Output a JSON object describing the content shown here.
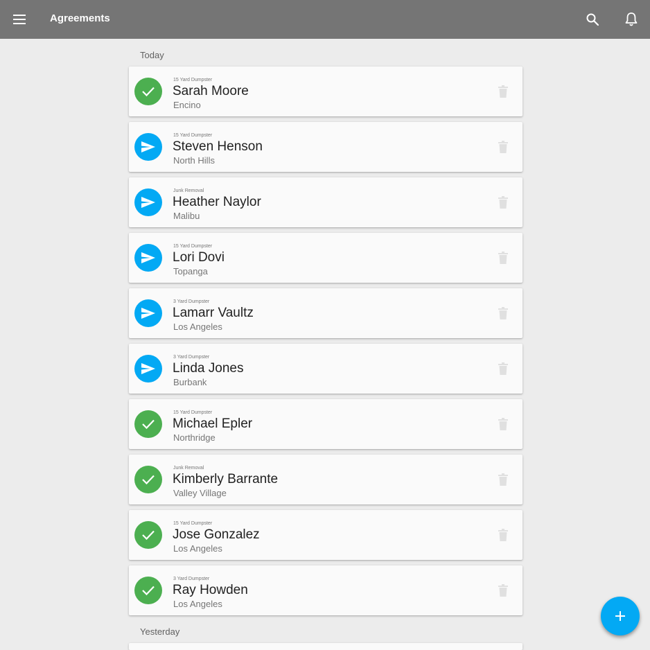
{
  "appbar": {
    "title": "Agreements",
    "icons": [
      "menu-icon",
      "search-icon",
      "bell-icon"
    ]
  },
  "sections": [
    {
      "label": "Today",
      "agreements": [
        {
          "service": "15 Yard Dumpster",
          "name": "Sarah Moore",
          "city": "Encino",
          "status": "signed"
        },
        {
          "service": "15 Yard Dumpster",
          "name": "Steven Henson",
          "city": "North Hills",
          "status": "sent"
        },
        {
          "service": "Junk Removal",
          "name": "Heather Naylor",
          "city": "Malibu",
          "status": "sent"
        },
        {
          "service": "15 Yard Dumpster",
          "name": "Lori Dovi",
          "city": "Topanga",
          "status": "sent"
        },
        {
          "service": "3 Yard Dumpster",
          "name": "Lamarr Vaultz",
          "city": "Los Angeles",
          "status": "sent"
        },
        {
          "service": "3 Yard Dumpster",
          "name": "Linda Jones",
          "city": "Burbank",
          "status": "sent"
        },
        {
          "service": "15 Yard Dumpster",
          "name": "Michael Epler",
          "city": "Northridge",
          "status": "signed"
        },
        {
          "service": "Junk Removal",
          "name": "Kimberly Barrante",
          "city": "Valley Village",
          "status": "signed"
        },
        {
          "service": "15 Yard Dumpster",
          "name": "Jose Gonzalez",
          "city": "Los Angeles",
          "status": "signed"
        },
        {
          "service": "3 Yard Dumpster",
          "name": "Ray Howden",
          "city": "Los Angeles",
          "status": "signed"
        }
      ]
    },
    {
      "label": "Yesterday",
      "agreements": []
    }
  ],
  "status_icons": {
    "signed": "check-icon",
    "sent": "send-icon"
  },
  "colors": {
    "appbar": "#757575",
    "signed": "#4caf50",
    "sent": "#03a9f4",
    "fab": "#03a9f4",
    "background": "#ececec"
  },
  "fab": {
    "icon": "plus-icon"
  }
}
